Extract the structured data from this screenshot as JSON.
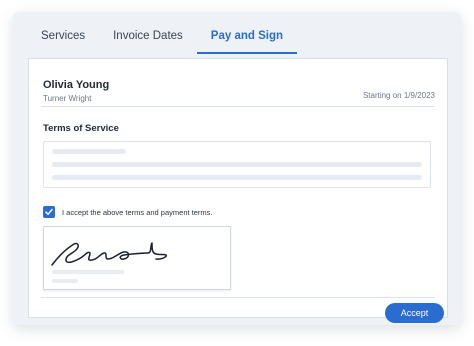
{
  "tabs": [
    {
      "label": "Services",
      "active": false
    },
    {
      "label": "Invoice Dates",
      "active": false
    },
    {
      "label": "Pay and Sign",
      "active": true
    }
  ],
  "client": {
    "name": "Olivia Young",
    "company": "Turner Wright",
    "start_date": "Starting on 1/9/2023"
  },
  "terms": {
    "title": "Terms of Service",
    "accept_label": "I accept the above terms and payment terms.",
    "accepted": true
  },
  "signature": {
    "signed": true,
    "icon": "handwritten-signature"
  },
  "actions": {
    "accept_label": "Accept"
  },
  "colors": {
    "accent": "#2a6cd0",
    "panel_background": "#eef2f6",
    "placeholder_line": "#e6ebf1"
  }
}
